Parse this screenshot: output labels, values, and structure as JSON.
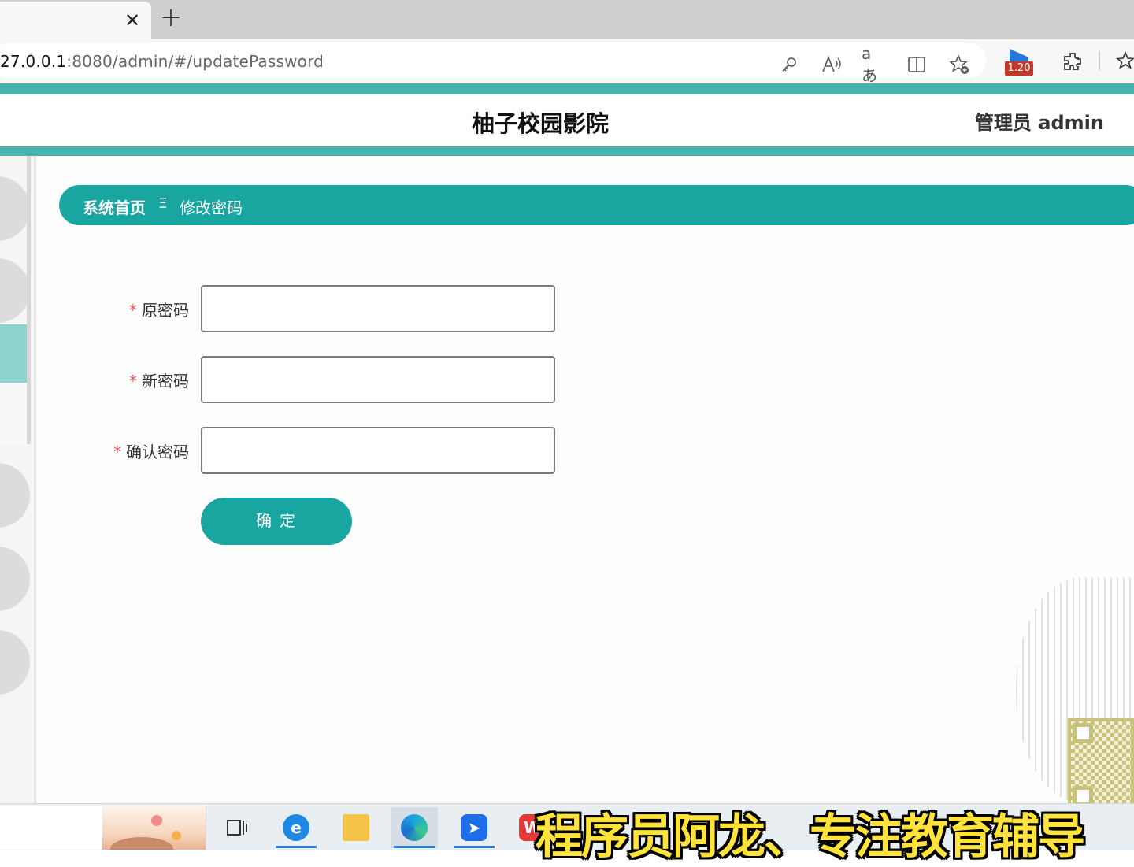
{
  "browser": {
    "tab_close": "✕",
    "new_tab": "+",
    "url_host": "27.0.0.1",
    "url_path": ":8080/admin/#/updatePassword",
    "toolbar_icons": [
      "password-key-icon",
      "read-aloud-icon",
      "translate-icon",
      "split-screen-icon",
      "add-favorite-icon",
      "extension-badge-icon",
      "extensions-icon",
      "favorites-icon"
    ],
    "badge_value": "1.20"
  },
  "header": {
    "site_title": "柚子校园影院",
    "admin_label": "管理员 admin",
    "accent_color": "#4bb3ad"
  },
  "breadcrumb": {
    "home": "系统首页",
    "separator": "Ξ",
    "current": "修改密码",
    "color": "#1aa6a0"
  },
  "form": {
    "required_mark": "*",
    "fields": [
      {
        "label": "原密码",
        "value": ""
      },
      {
        "label": "新密码",
        "value": ""
      },
      {
        "label": "确认密码",
        "value": ""
      }
    ],
    "submit_label": "确定"
  },
  "taskbar": {
    "apps": [
      "task-view-icon",
      "ie-icon",
      "file-explorer-icon",
      "edge-icon",
      "feishu-icon",
      "wps-icon"
    ]
  },
  "overlay": {
    "caption": "程序员阿龙、专注教育辅导"
  }
}
